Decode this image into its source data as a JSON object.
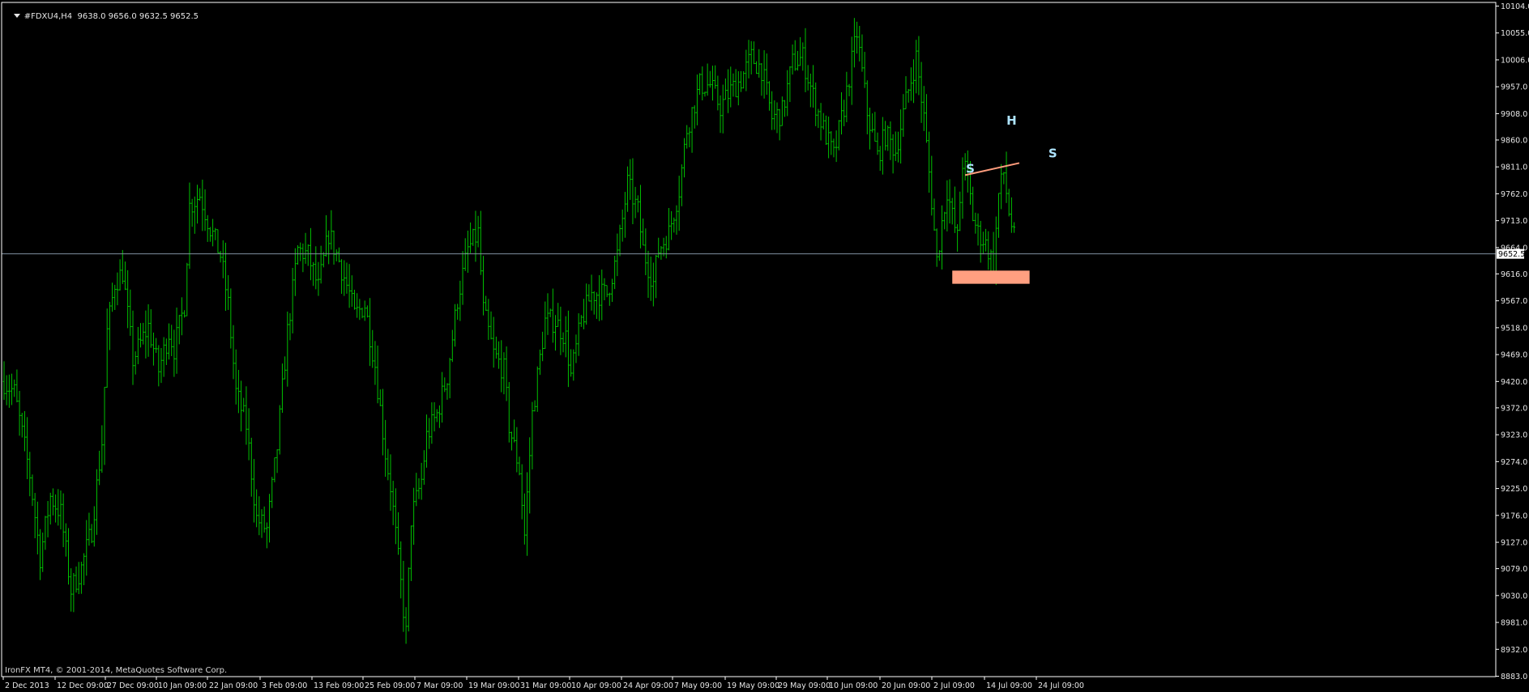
{
  "window": {
    "symbol_title": "#FDXU4,H4",
    "ohlc": "9638.0 9656.0 9632.5 9652.5",
    "copyright": "IronFX MT4, © 2001-2014, MetaQuotes Software Corp."
  },
  "colors": {
    "background": "#000000",
    "bars": "#00c000",
    "axis": "#ffffff",
    "text": "#e6e6e6",
    "bid_line": "#7f8f9f",
    "neckline": "#ff9c7c",
    "support_zone": "#ff9f80",
    "pattern_labels": "#aee4ff",
    "price_tag_bg": "#ffffff",
    "price_tag_text": "#000000"
  },
  "chart_data": {
    "type": "ohlc",
    "chart_style": "bars",
    "timeframe": "H4",
    "ylim": [
      8883.0,
      10104.0
    ],
    "y_ticks": [
      10104.0,
      10055.0,
      10006.0,
      9957.0,
      9908.0,
      9860.0,
      9811.0,
      9762.0,
      9713.0,
      9664.0,
      9616.0,
      9567.0,
      9518.0,
      9469.0,
      9420.0,
      9372.0,
      9323.0,
      9274.0,
      9225.0,
      9176.0,
      9127.0,
      9079.0,
      9030.0,
      8981.0,
      8932.0,
      8883.0
    ],
    "x_ticks": [
      "2 Dec 2013",
      "12 Dec 09:00",
      "27 Dec 09:00",
      "10 Jan 09:00",
      "22 Jan 09:00",
      "3 Feb 09:00",
      "13 Feb 09:00",
      "25 Feb 09:00",
      "7 Mar 09:00",
      "19 Mar 09:00",
      "31 Mar 09:00",
      "10 Apr 09:00",
      "24 Apr 09:00",
      "7 May 09:00",
      "19 May 09:00",
      "29 May 09:00",
      "10 Jun 09:00",
      "20 Jun 09:00",
      "2 Jul 09:00",
      "14 Jul 09:00",
      "24 Jul 09:00"
    ],
    "current_price": 9652.5,
    "price_path": [
      [
        0,
        9420
      ],
      [
        4,
        9400
      ],
      [
        10,
        9250
      ],
      [
        14,
        9100
      ],
      [
        18,
        9210
      ],
      [
        22,
        9180
      ],
      [
        26,
        9040
      ],
      [
        30,
        9080
      ],
      [
        34,
        9150
      ],
      [
        38,
        9310
      ],
      [
        40,
        9510
      ],
      [
        43,
        9600
      ],
      [
        46,
        9620
      ],
      [
        50,
        9460
      ],
      [
        56,
        9520
      ],
      [
        60,
        9440
      ],
      [
        64,
        9510
      ],
      [
        66,
        9480
      ],
      [
        70,
        9560
      ],
      [
        72,
        9740
      ],
      [
        76,
        9760
      ],
      [
        80,
        9700
      ],
      [
        84,
        9650
      ],
      [
        87,
        9560
      ],
      [
        90,
        9400
      ],
      [
        94,
        9340
      ],
      [
        98,
        9170
      ],
      [
        102,
        9150
      ],
      [
        106,
        9300
      ],
      [
        110,
        9510
      ],
      [
        114,
        9660
      ],
      [
        118,
        9650
      ],
      [
        122,
        9590
      ],
      [
        126,
        9690
      ],
      [
        130,
        9640
      ],
      [
        134,
        9580
      ],
      [
        136,
        9540
      ],
      [
        140,
        9560
      ],
      [
        144,
        9450
      ],
      [
        148,
        9290
      ],
      [
        150,
        9230
      ],
      [
        154,
        9050
      ],
      [
        156,
        8960
      ],
      [
        158,
        9170
      ],
      [
        162,
        9240
      ],
      [
        164,
        9320
      ],
      [
        168,
        9360
      ],
      [
        172,
        9430
      ],
      [
        176,
        9570
      ],
      [
        180,
        9660
      ],
      [
        184,
        9690
      ],
      [
        186,
        9550
      ],
      [
        190,
        9470
      ],
      [
        194,
        9440
      ],
      [
        196,
        9340
      ],
      [
        200,
        9260
      ],
      [
        202,
        9140
      ],
      [
        205,
        9360
      ],
      [
        210,
        9530
      ],
      [
        214,
        9530
      ],
      [
        218,
        9500
      ],
      [
        220,
        9430
      ],
      [
        224,
        9530
      ],
      [
        228,
        9580
      ],
      [
        234,
        9580
      ],
      [
        238,
        9650
      ],
      [
        242,
        9780
      ],
      [
        246,
        9730
      ],
      [
        248,
        9660
      ],
      [
        252,
        9600
      ],
      [
        254,
        9660
      ],
      [
        258,
        9690
      ],
      [
        262,
        9770
      ],
      [
        265,
        9880
      ],
      [
        270,
        9960
      ],
      [
        274,
        9960
      ],
      [
        278,
        9920
      ],
      [
        282,
        9950
      ],
      [
        286,
        9970
      ],
      [
        290,
        10010
      ],
      [
        294,
        9990
      ],
      [
        298,
        9900
      ],
      [
        302,
        9910
      ],
      [
        306,
        10000
      ],
      [
        310,
        10010
      ],
      [
        314,
        9940
      ],
      [
        318,
        9880
      ],
      [
        322,
        9830
      ],
      [
        326,
        9920
      ],
      [
        330,
        10030
      ],
      [
        331,
        10055
      ],
      [
        335,
        9910
      ],
      [
        339,
        9830
      ],
      [
        342,
        9870
      ],
      [
        346,
        9840
      ],
      [
        350,
        9930
      ],
      [
        354,
        10010
      ],
      [
        357,
        9900
      ],
      [
        360,
        9750
      ],
      [
        362,
        9640
      ],
      [
        364,
        9710
      ],
      [
        366,
        9770
      ],
      [
        368,
        9720
      ],
      [
        370,
        9680
      ],
      [
        372,
        9820
      ],
      [
        374,
        9790
      ],
      [
        376,
        9720
      ],
      [
        378,
        9690
      ],
      [
        380,
        9680
      ],
      [
        382,
        9660
      ],
      [
        384,
        9630
      ],
      [
        386,
        9760
      ],
      [
        388,
        9800
      ],
      [
        390,
        9730
      ],
      [
        392,
        9680
      ]
    ]
  },
  "annotations": {
    "pattern_left_shoulder": "S",
    "pattern_head": "H",
    "pattern_right_shoulder": "S",
    "neckline_from": [
      373,
      9796
    ],
    "neckline_to": [
      394,
      9818
    ],
    "zone_from_to": [
      368,
      398
    ],
    "zone_price_range": [
      9598,
      9622
    ]
  }
}
